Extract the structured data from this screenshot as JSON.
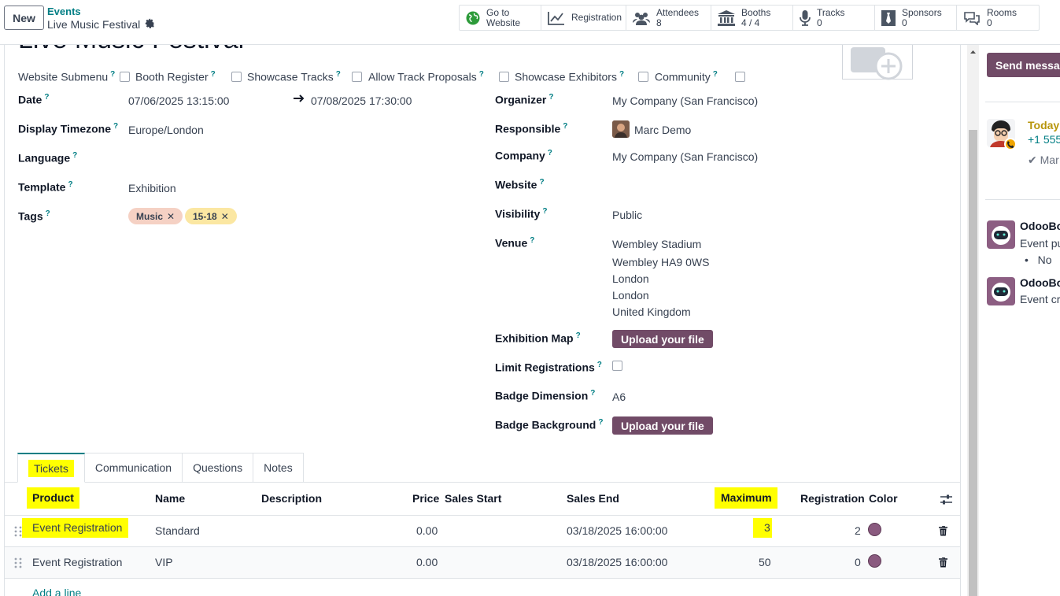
{
  "topbar": {
    "new_label": "New",
    "breadcrumb_parent": "Events",
    "breadcrumb_current": "Live Music Festival"
  },
  "smart_buttons": {
    "website": {
      "line1": "Go to",
      "line2": "Website"
    },
    "registration": {
      "label": "Registration"
    },
    "attendees": {
      "label": "Attendees",
      "count": "8"
    },
    "booths": {
      "label": "Booths",
      "count": "4 / 4"
    },
    "tracks": {
      "label": "Tracks",
      "count": "0"
    },
    "sponsors": {
      "label": "Sponsors",
      "count": "0"
    },
    "rooms": {
      "label": "Rooms",
      "count": "0"
    }
  },
  "form": {
    "title": "Live Music Festival",
    "options": {
      "website_submenu": "Website Submenu",
      "booth_register": "Booth Register",
      "showcase_tracks": "Showcase Tracks",
      "allow_track_proposals": "Allow Track Proposals",
      "showcase_exhibitors": "Showcase Exhibitors",
      "community": "Community"
    },
    "left": {
      "date_label": "Date",
      "date_start": "07/06/2025 13:15:00",
      "date_end": "07/08/2025 17:30:00",
      "timezone_label": "Display Timezone",
      "timezone_value": "Europe/London",
      "language_label": "Language",
      "template_label": "Template",
      "template_value": "Exhibition",
      "tags_label": "Tags",
      "tags": [
        "Music",
        "15-18"
      ]
    },
    "right": {
      "organizer_label": "Organizer",
      "organizer_value": "My Company (San Francisco)",
      "responsible_label": "Responsible",
      "responsible_value": "Marc Demo",
      "company_label": "Company",
      "company_value": "My Company (San Francisco)",
      "website_label": "Website",
      "visibility_label": "Visibility",
      "visibility_value": "Public",
      "venue_label": "Venue",
      "venue_lines": [
        "Wembley Stadium",
        "Wembley HA9 0WS",
        "London",
        "London",
        "United Kingdom"
      ],
      "exhibition_map_label": "Exhibition Map",
      "upload_label": "Upload your file",
      "limit_registrations_label": "Limit Registrations",
      "badge_dimension_label": "Badge Dimension",
      "badge_dimension_value": "A6",
      "badge_background_label": "Badge Background"
    }
  },
  "tabs": [
    "Tickets",
    "Communication",
    "Questions",
    "Notes"
  ],
  "tickets": {
    "columns": {
      "product": "Product",
      "name": "Name",
      "description": "Description",
      "price": "Price",
      "sales_start": "Sales Start",
      "sales_end": "Sales End",
      "maximum": "Maximum",
      "registration": "Registration",
      "color": "Color"
    },
    "rows": [
      {
        "product": "Event Registration",
        "name": "Standard",
        "price": "0.00",
        "sales_end": "03/18/2025 16:00:00",
        "maximum": "3",
        "registration": "2"
      },
      {
        "product": "Event Registration",
        "name": "VIP",
        "price": "0.00",
        "sales_end": "03/18/2025 16:00:00",
        "maximum": "50",
        "registration": "0"
      }
    ],
    "add_line": "Add a line"
  },
  "chatter": {
    "send_label": "Send message",
    "today_label": "Today:",
    "phone": "+1 555",
    "done_text": "Mar",
    "bot_name": "OdooBot",
    "msg1": "Event pu",
    "msg1_bullet": "No",
    "msg2": "Event cre"
  },
  "colors": {
    "accent": "#017e84",
    "primary": "#714b67",
    "highlight": "#ffff00"
  }
}
